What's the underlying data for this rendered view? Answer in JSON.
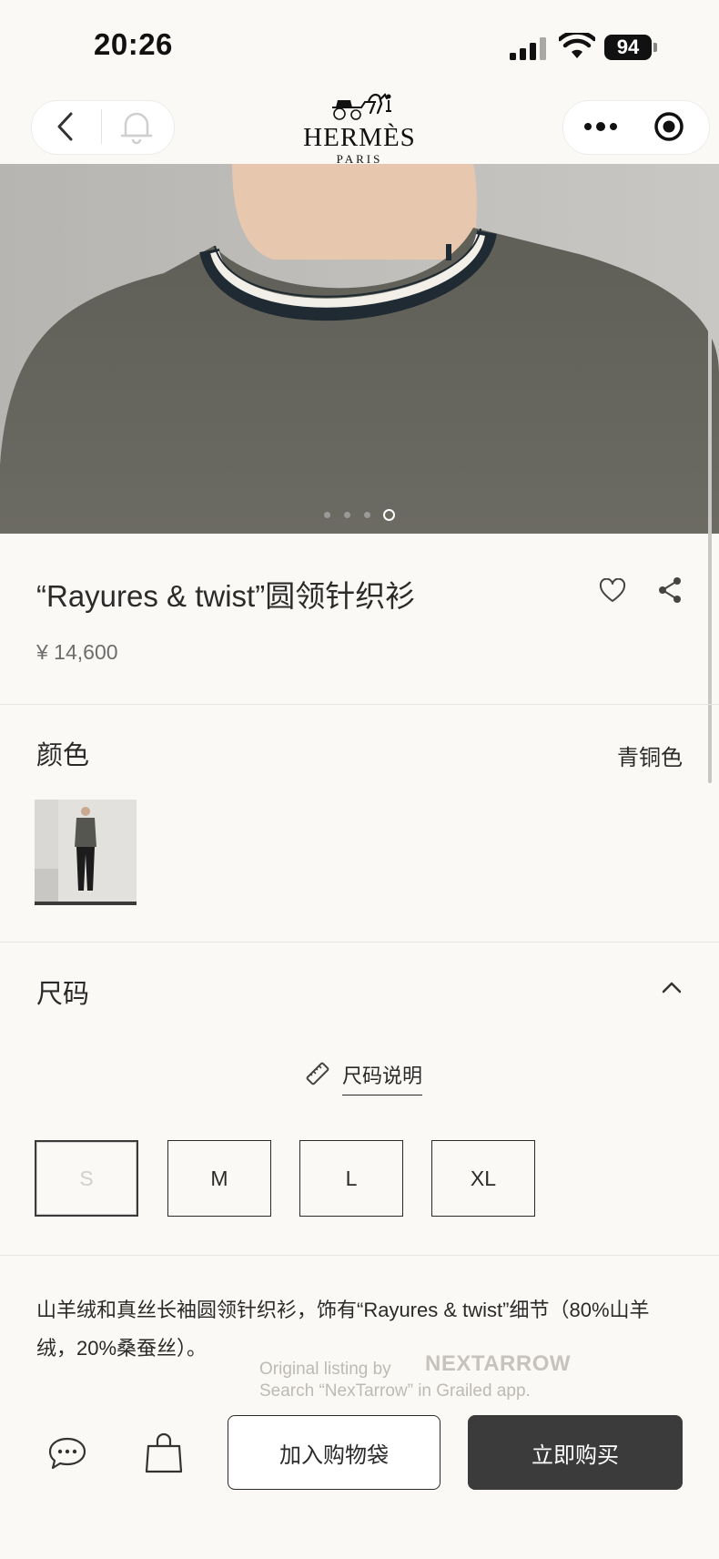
{
  "status_bar": {
    "time": "20:26",
    "battery": "94"
  },
  "header": {
    "brand": "HERMÈS",
    "brand_sub": "PARIS"
  },
  "hero": {
    "page_count": 4,
    "active_page": 4
  },
  "product": {
    "title": "“Rayures & twist”圆领针织衫",
    "price": "¥ 14,600"
  },
  "color_section": {
    "label": "颜色",
    "value": "青铜色"
  },
  "size_section": {
    "label": "尺码",
    "guide_label": "尺码说明",
    "sizes": [
      "S",
      "M",
      "L",
      "XL"
    ],
    "unavailable": [
      "S"
    ]
  },
  "description": "山羊绒和真丝长袖圆领针织衫，饰有“Rayures & twist”细节（80%山羊绒，20%桑蚕丝）。",
  "watermark": {
    "line1": "Original listing by",
    "brand": "NEXTARROW",
    "line2": "Search “NexTarrow” in Grailed app."
  },
  "bottom_bar": {
    "add_to_bag": "加入购物袋",
    "buy_now": "立即购买"
  }
}
